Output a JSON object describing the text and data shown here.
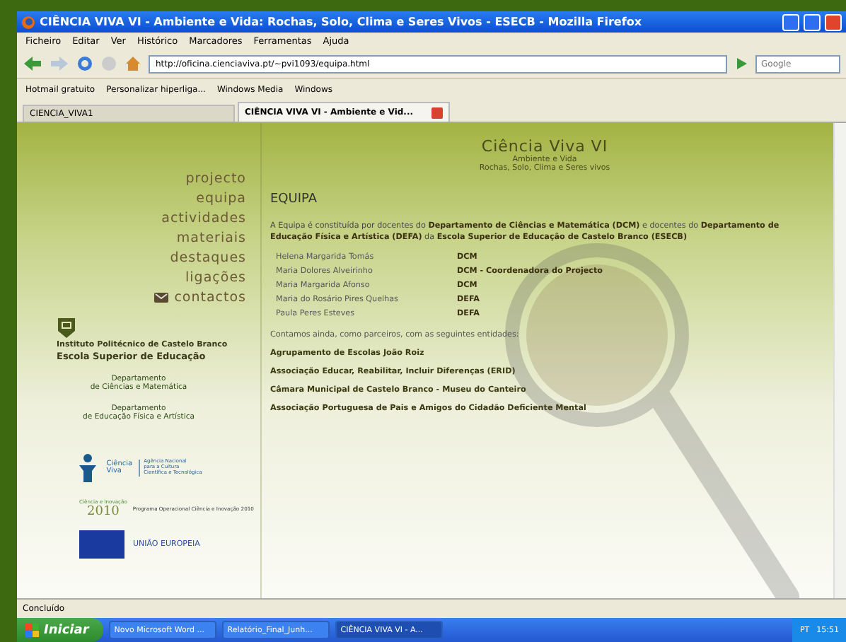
{
  "window": {
    "title": "CIÊNCIA VIVA VI - Ambiente e Vida: Rochas, Solo, Clima e Seres Vivos - ESECB - Mozilla Firefox"
  },
  "menu_bar": [
    "Ficheiro",
    "Editar",
    "Ver",
    "Histórico",
    "Marcadores",
    "Ferramentas",
    "Ajuda"
  ],
  "toolbar": {
    "url": "http://oficina.cienciaviva.pt/~pvi1093/equipa.html",
    "search_placeholder": "Google"
  },
  "bookmarks": [
    "Hotmail gratuito",
    "Personalizar hiperliga...",
    "Windows Media",
    "Windows"
  ],
  "tabs": [
    {
      "label": "CIENCIA_VIVA1",
      "selected": false
    },
    {
      "label": "CIÊNCIA VIVA VI - Ambiente e Vid...",
      "selected": true
    }
  ],
  "page": {
    "site_title": "Ciência Viva VI",
    "subtitle_lines": [
      "Ambiente e Vida",
      "Rochas, Solo, Clima e Seres vivos"
    ],
    "nav": [
      {
        "label": "projecto",
        "kind": "link"
      },
      {
        "label": "equipa",
        "kind": "link"
      },
      {
        "label": "actividades",
        "kind": "link"
      },
      {
        "label": "materiais",
        "kind": "link"
      },
      {
        "label": "destaques",
        "kind": "link"
      },
      {
        "label": "ligações",
        "kind": "link"
      },
      {
        "label": "contactos",
        "kind": "mail"
      }
    ],
    "institute": [
      "Instituto Politécnico de Castelo Branco",
      "Escola Superior de Educação"
    ],
    "departments": [
      [
        "Departamento",
        "de Ciências e Matemática"
      ],
      [
        "Departamento",
        "de Educação Física e Artística"
      ]
    ],
    "agency_logo": {
      "name_lines": [
        "Ciência",
        "Viva"
      ],
      "caption_lines": [
        "Agência Nacional",
        "para a Cultura",
        "Científica e Tecnológica"
      ]
    },
    "programme_logo": {
      "name": "Ciência e Inovação",
      "year": "2010",
      "caption": "Programa Operacional Ciência e Inovação 2010"
    },
    "eu_logo": {
      "caption": "UNIÃO EUROPEIA"
    },
    "heading": "EQUIPA",
    "intro": "A Equipa é constituída por docentes do **Departamento de Ciências e Matemática (DCM)** e docentes do **Departamento de Educação Física e Artística (DEFA)** da **Escola Superior de Educação de Castelo Branco (ESECB)**",
    "members": [
      {
        "name": "Helena Margarida Tomás",
        "department": "DCM"
      },
      {
        "name": "Maria Dolores Alveirinho",
        "department": "DCM - Coordenadora do Projecto"
      },
      {
        "name": "Maria Margarida Afonso",
        "department": "DCM"
      },
      {
        "name": "Maria do Rosário Pires Quelhas",
        "department": "DEFA"
      },
      {
        "name": "Paula Peres Esteves",
        "department": "DEFA"
      }
    ],
    "partners_intro": "Contamos ainda, como parceiros, com as seguintes entidades:",
    "partners": [
      "Agrupamento de Escolas João Roiz",
      "Associação Educar, Reabilitar, Incluir Diferenças (ERID)",
      "Câmara Municipal de Castelo Branco - Museu do Canteiro",
      "Associação Portuguesa de Pais e Amigos do Cidadão Deficiente Mental"
    ]
  },
  "status_bar": "Concluído",
  "taskbar": {
    "start": "Iniciar",
    "tasks": [
      {
        "label": "Novo Microsoft Word ...",
        "selected": false
      },
      {
        "label": "Relatório_Final_Junh...",
        "selected": false
      },
      {
        "label": "CIÊNCIA VIVA VI - A...",
        "selected": true
      }
    ],
    "language": "PT",
    "clock": "15:51"
  }
}
